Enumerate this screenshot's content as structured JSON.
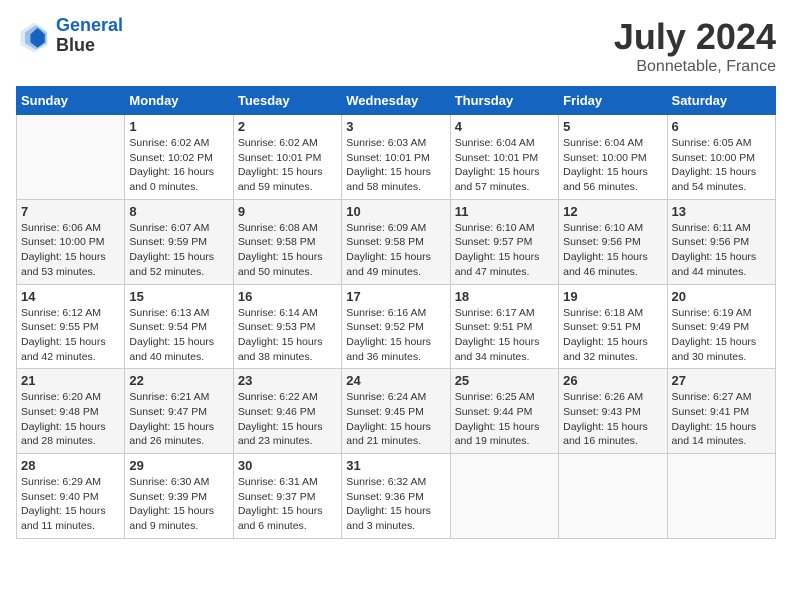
{
  "logo": {
    "line1": "General",
    "line2": "Blue"
  },
  "title": "July 2024",
  "location": "Bonnetable, France",
  "days_of_week": [
    "Sunday",
    "Monday",
    "Tuesday",
    "Wednesday",
    "Thursday",
    "Friday",
    "Saturday"
  ],
  "weeks": [
    [
      {
        "day": "",
        "empty": true
      },
      {
        "day": "1",
        "sunrise": "6:02 AM",
        "sunset": "10:02 PM",
        "daylight": "16 hours and 0 minutes."
      },
      {
        "day": "2",
        "sunrise": "6:02 AM",
        "sunset": "10:01 PM",
        "daylight": "15 hours and 59 minutes."
      },
      {
        "day": "3",
        "sunrise": "6:03 AM",
        "sunset": "10:01 PM",
        "daylight": "15 hours and 58 minutes."
      },
      {
        "day": "4",
        "sunrise": "6:04 AM",
        "sunset": "10:01 PM",
        "daylight": "15 hours and 57 minutes."
      },
      {
        "day": "5",
        "sunrise": "6:04 AM",
        "sunset": "10:00 PM",
        "daylight": "15 hours and 56 minutes."
      },
      {
        "day": "6",
        "sunrise": "6:05 AM",
        "sunset": "10:00 PM",
        "daylight": "15 hours and 54 minutes."
      }
    ],
    [
      {
        "day": "7",
        "sunrise": "6:06 AM",
        "sunset": "10:00 PM",
        "daylight": "15 hours and 53 minutes."
      },
      {
        "day": "8",
        "sunrise": "6:07 AM",
        "sunset": "9:59 PM",
        "daylight": "15 hours and 52 minutes."
      },
      {
        "day": "9",
        "sunrise": "6:08 AM",
        "sunset": "9:58 PM",
        "daylight": "15 hours and 50 minutes."
      },
      {
        "day": "10",
        "sunrise": "6:09 AM",
        "sunset": "9:58 PM",
        "daylight": "15 hours and 49 minutes."
      },
      {
        "day": "11",
        "sunrise": "6:10 AM",
        "sunset": "9:57 PM",
        "daylight": "15 hours and 47 minutes."
      },
      {
        "day": "12",
        "sunrise": "6:10 AM",
        "sunset": "9:56 PM",
        "daylight": "15 hours and 46 minutes."
      },
      {
        "day": "13",
        "sunrise": "6:11 AM",
        "sunset": "9:56 PM",
        "daylight": "15 hours and 44 minutes."
      }
    ],
    [
      {
        "day": "14",
        "sunrise": "6:12 AM",
        "sunset": "9:55 PM",
        "daylight": "15 hours and 42 minutes."
      },
      {
        "day": "15",
        "sunrise": "6:13 AM",
        "sunset": "9:54 PM",
        "daylight": "15 hours and 40 minutes."
      },
      {
        "day": "16",
        "sunrise": "6:14 AM",
        "sunset": "9:53 PM",
        "daylight": "15 hours and 38 minutes."
      },
      {
        "day": "17",
        "sunrise": "6:16 AM",
        "sunset": "9:52 PM",
        "daylight": "15 hours and 36 minutes."
      },
      {
        "day": "18",
        "sunrise": "6:17 AM",
        "sunset": "9:51 PM",
        "daylight": "15 hours and 34 minutes."
      },
      {
        "day": "19",
        "sunrise": "6:18 AM",
        "sunset": "9:51 PM",
        "daylight": "15 hours and 32 minutes."
      },
      {
        "day": "20",
        "sunrise": "6:19 AM",
        "sunset": "9:49 PM",
        "daylight": "15 hours and 30 minutes."
      }
    ],
    [
      {
        "day": "21",
        "sunrise": "6:20 AM",
        "sunset": "9:48 PM",
        "daylight": "15 hours and 28 minutes."
      },
      {
        "day": "22",
        "sunrise": "6:21 AM",
        "sunset": "9:47 PM",
        "daylight": "15 hours and 26 minutes."
      },
      {
        "day": "23",
        "sunrise": "6:22 AM",
        "sunset": "9:46 PM",
        "daylight": "15 hours and 23 minutes."
      },
      {
        "day": "24",
        "sunrise": "6:24 AM",
        "sunset": "9:45 PM",
        "daylight": "15 hours and 21 minutes."
      },
      {
        "day": "25",
        "sunrise": "6:25 AM",
        "sunset": "9:44 PM",
        "daylight": "15 hours and 19 minutes."
      },
      {
        "day": "26",
        "sunrise": "6:26 AM",
        "sunset": "9:43 PM",
        "daylight": "15 hours and 16 minutes."
      },
      {
        "day": "27",
        "sunrise": "6:27 AM",
        "sunset": "9:41 PM",
        "daylight": "15 hours and 14 minutes."
      }
    ],
    [
      {
        "day": "28",
        "sunrise": "6:29 AM",
        "sunset": "9:40 PM",
        "daylight": "15 hours and 11 minutes."
      },
      {
        "day": "29",
        "sunrise": "6:30 AM",
        "sunset": "9:39 PM",
        "daylight": "15 hours and 9 minutes."
      },
      {
        "day": "30",
        "sunrise": "6:31 AM",
        "sunset": "9:37 PM",
        "daylight": "15 hours and 6 minutes."
      },
      {
        "day": "31",
        "sunrise": "6:32 AM",
        "sunset": "9:36 PM",
        "daylight": "15 hours and 3 minutes."
      },
      {
        "day": "",
        "empty": true
      },
      {
        "day": "",
        "empty": true
      },
      {
        "day": "",
        "empty": true
      }
    ]
  ],
  "labels": {
    "sunrise": "Sunrise:",
    "sunset": "Sunset:",
    "daylight": "Daylight hours"
  }
}
